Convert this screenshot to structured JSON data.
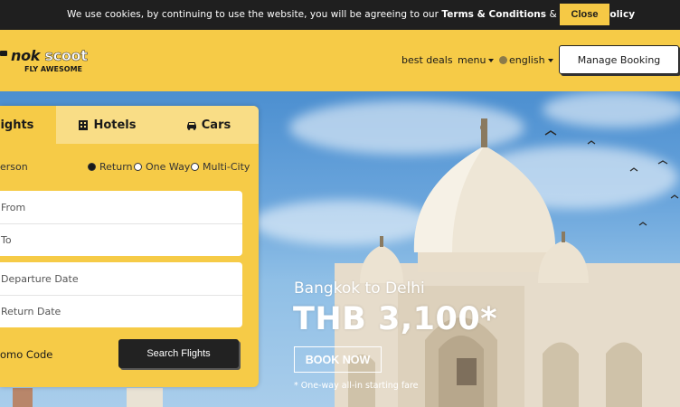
{
  "cookie": {
    "text_prefix": "We use cookies, by continuing to use the website, you will be agreeing to our ",
    "terms": "Terms & Conditions",
    "and": " & ",
    "privacy": "Privacy Policy",
    "close_label": "Close"
  },
  "header": {
    "logo_text_1": "nok",
    "logo_text_2": "scoot",
    "logo_tagline": "FLY AWESOME",
    "nav": {
      "best_deals": "best deals",
      "menu": "menu",
      "language": "english"
    },
    "manage_booking": "Manage Booking"
  },
  "search": {
    "tabs": {
      "flights": "lights",
      "hotels": "Hotels",
      "cars": "Cars"
    },
    "person_label": "erson",
    "trip_types": {
      "return": "Return",
      "one_way": "One Way",
      "multi_city": "Multi-City",
      "selected": "return"
    },
    "from_placeholder": "From",
    "to_placeholder": "To",
    "departure_placeholder": "Departure Date",
    "return_placeholder": "Return Date",
    "promo_code_label": "omo Code",
    "search_button": "Search Flights"
  },
  "promo": {
    "route": "Bangkok to Delhi",
    "price": "THB 3,100*",
    "cta": "BOOK NOW",
    "note": "* One-way all-in starting fare"
  },
  "colors": {
    "brand_yellow": "#f6cb47",
    "dark": "#1f1f1f"
  }
}
